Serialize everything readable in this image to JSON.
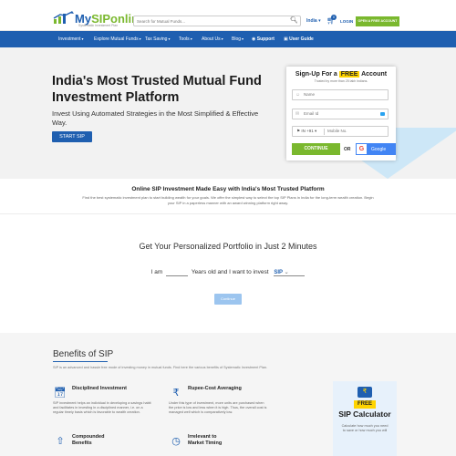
{
  "header": {
    "logo_text_my": "My",
    "logo_text_brand": "SIPonline",
    "tagline": "Systematic Investment Plan",
    "search_placeholder": "Search for Mutual Funds...",
    "language": "India",
    "cart_count": "0",
    "login_label": "LOGIN",
    "open_account_label": "OPEN A FREE ACCOUNT"
  },
  "nav": {
    "items": [
      {
        "label": "Investment",
        "dropdown": true
      },
      {
        "label": "Explore Mutual Funds",
        "dropdown": true
      },
      {
        "label": "Tax Saving",
        "dropdown": true
      },
      {
        "label": "Tools",
        "dropdown": true
      },
      {
        "label": "About Us",
        "dropdown": true
      },
      {
        "label": "Blog",
        "dropdown": true
      },
      {
        "label": "Support",
        "dropdown": false
      },
      {
        "label": "User Guide",
        "dropdown": false
      }
    ]
  },
  "hero": {
    "title": "India's Most Trusted Mutual Fund Investment Platform",
    "subtitle": "Invest Using Automated Strategies in the Most Simplified & Effective Way.",
    "cta_label": "START SIP"
  },
  "signup": {
    "title_prefix": "Sign-Up For a",
    "title_badge": "FREE",
    "title_suffix": "Account",
    "trust_text": "Trusted by more than 25 lakh Indians.",
    "name_placeholder": "Name",
    "email_placeholder": "Email Id",
    "country_code": "IN +91",
    "mobile_placeholder": "Mobile No.",
    "continue_label": "CONTINUE",
    "or_label": "OR",
    "google_label": "Google"
  },
  "online_section": {
    "title": "Online SIP Investment Made Easy with India's Most Trusted Platform",
    "description": "Find the best systematic investment plan to start building wealth for your goals. We offer the simplest way to select the top SIP Plans in India for the long-term wealth creation. Begin your SIP in a paperless manner with an award winning platform right away."
  },
  "portfolio": {
    "title": "Get Your Personalized Portfolio in Just 2 Minutes",
    "text_i_am": "I am",
    "text_years_old": "Years old and I want to invest",
    "invest_type": "SIP",
    "continue_label": "Continue"
  },
  "benefits": {
    "title": "Benefits of SIP",
    "description": "SIP is an advanced and hassle free mode of investing money in mutual funds. Find here the various benefits of Systematic Investment Plan.",
    "items": [
      {
        "title": "Disciplined Investment",
        "description": "SIP investment helps an individual in developing a savings habit and facilitates in investing in a disciplined manner, i.e. on a regular timely basis which is favorable to wealth creation.",
        "icon": "calendar-icon"
      },
      {
        "title": "Rupee-Cost Averaging",
        "description": "Under this type of investment, more units are purchased when the price is low and less when it is high. Thus, the overall cost is managed well which is comparatively low.",
        "icon": "rupee-icon"
      },
      {
        "title": "Compounded Benefits",
        "description": "",
        "icon": "growth-icon"
      },
      {
        "title": "Irrelevant to Market Timing",
        "description": "",
        "icon": "clock-icon"
      }
    ]
  },
  "sip_calculator": {
    "badge": "FREE",
    "title": "SIP Calculator",
    "description": "Calculate how much you need to save or how much you will"
  },
  "colors": {
    "brand_blue": "#1f5fb0",
    "brand_green": "#7ab82e",
    "badge_yellow": "#ffd400"
  }
}
